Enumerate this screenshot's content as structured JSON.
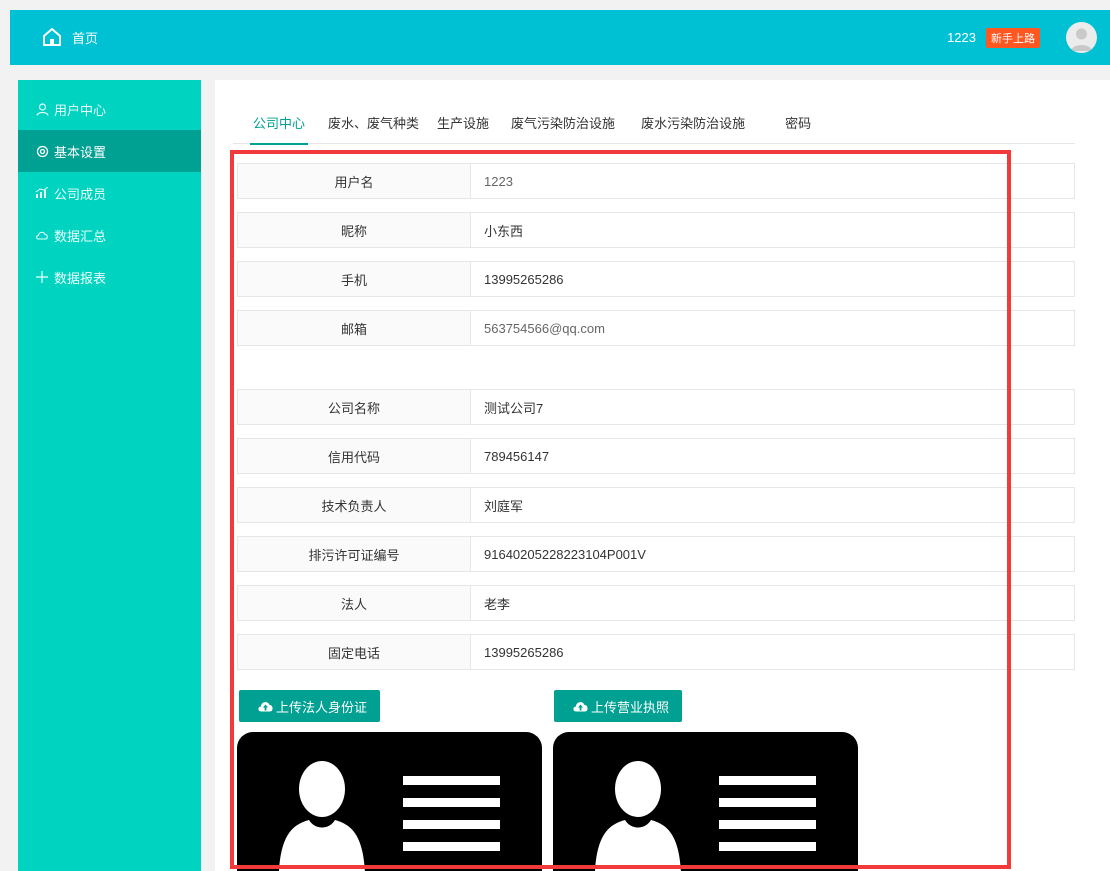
{
  "header": {
    "home_label": "首页",
    "username": "1223",
    "badge": "新手上路"
  },
  "sidebar": {
    "items": [
      {
        "label": "用户中心",
        "icon": "user-icon"
      },
      {
        "label": "基本设置",
        "icon": "gear-icon"
      },
      {
        "label": "公司成员",
        "icon": "chart-icon"
      },
      {
        "label": "数据汇总",
        "icon": "cloud-icon"
      },
      {
        "label": "数据报表",
        "icon": "plus-icon"
      }
    ],
    "active_index": 1
  },
  "tabs": [
    "公司中心",
    "废水、废气种类",
    "生产设施",
    "废气污染防治设施",
    "废水污染防治设施",
    "密码"
  ],
  "form": {
    "user_rows": [
      {
        "label": "用户名",
        "value": "1223"
      },
      {
        "label": "昵称",
        "value": "小东西"
      },
      {
        "label": "手机",
        "value": "13995265286"
      },
      {
        "label": "邮箱",
        "value": "563754566@qq.com"
      }
    ],
    "company_rows": [
      {
        "label": "公司名称",
        "value": "测试公司7"
      },
      {
        "label": "信用代码",
        "value": "789456147"
      },
      {
        "label": "技术负责人",
        "value": "刘庭军"
      },
      {
        "label": "排污许可证编号",
        "value": "91640205228223104P001V"
      },
      {
        "label": "法人",
        "value": "老李"
      },
      {
        "label": "固定电话",
        "value": "13995265286"
      }
    ]
  },
  "uploads": {
    "legal_id_label": "上传法人身份证",
    "license_label": "上传营业执照"
  },
  "colors": {
    "header": "#00c1d4",
    "sidebar": "#00d3c0",
    "sidebar_active": "#00a092",
    "accent": "#00a092",
    "highlight": "#f23a3a",
    "badge": "#ff5722"
  }
}
